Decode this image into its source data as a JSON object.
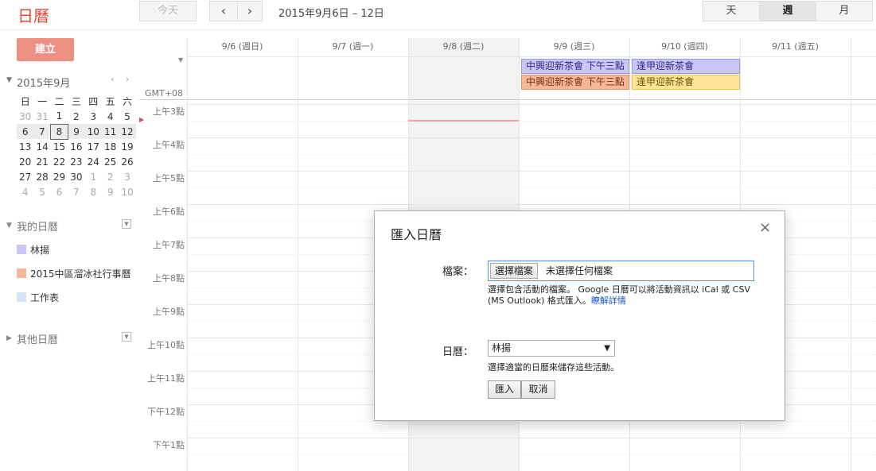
{
  "app": {
    "title": "日曆"
  },
  "toolbar": {
    "today": "今天",
    "prev": "‹",
    "next": "›",
    "date_range": "2015年9月6日 – 12日",
    "views": {
      "day": "天",
      "week": "週",
      "month": "月"
    },
    "selected_view": "week"
  },
  "sidebar": {
    "create": "建立",
    "mini_calendar": {
      "month_label": "2015年9月",
      "prev": "‹",
      "next": "›",
      "weekdays": [
        "日",
        "一",
        "二",
        "三",
        "四",
        "五",
        "六"
      ],
      "weeks": [
        [
          {
            "d": "30",
            "o": true
          },
          {
            "d": "31",
            "o": true
          },
          {
            "d": "1"
          },
          {
            "d": "2"
          },
          {
            "d": "3"
          },
          {
            "d": "4"
          },
          {
            "d": "5"
          }
        ],
        [
          {
            "d": "6"
          },
          {
            "d": "7"
          },
          {
            "d": "8",
            "today": true
          },
          {
            "d": "9"
          },
          {
            "d": "10"
          },
          {
            "d": "11"
          },
          {
            "d": "12"
          }
        ],
        [
          {
            "d": "13"
          },
          {
            "d": "14"
          },
          {
            "d": "15"
          },
          {
            "d": "16"
          },
          {
            "d": "17"
          },
          {
            "d": "18"
          },
          {
            "d": "19"
          }
        ],
        [
          {
            "d": "20"
          },
          {
            "d": "21"
          },
          {
            "d": "22"
          },
          {
            "d": "23"
          },
          {
            "d": "24"
          },
          {
            "d": "25"
          },
          {
            "d": "26"
          }
        ],
        [
          {
            "d": "27"
          },
          {
            "d": "28"
          },
          {
            "d": "29"
          },
          {
            "d": "30"
          },
          {
            "d": "1",
            "o": true
          },
          {
            "d": "2",
            "o": true
          },
          {
            "d": "3",
            "o": true
          }
        ],
        [
          {
            "d": "4",
            "o": true
          },
          {
            "d": "5",
            "o": true
          },
          {
            "d": "6",
            "o": true
          },
          {
            "d": "7",
            "o": true
          },
          {
            "d": "8",
            "o": true
          },
          {
            "d": "9",
            "o": true
          },
          {
            "d": "10",
            "o": true
          }
        ]
      ],
      "selected_week_index": 1
    },
    "my_calendars": {
      "title": "我的日曆",
      "items": [
        {
          "name": "林揚",
          "color": "#c9c6f5"
        },
        {
          "name": "2015中區溜冰社行事曆",
          "color": "#f6b699"
        },
        {
          "name": "工作表",
          "color": "#d4e3f6"
        }
      ]
    },
    "other_calendars": {
      "title": "其他日曆"
    }
  },
  "grid": {
    "timezone": "GMT+08",
    "days": [
      "9/6 (週日)",
      "9/7 (週一)",
      "9/8 (週二)",
      "9/9 (週三)",
      "9/10 (週四)",
      "9/11 (週五)"
    ],
    "today_index": 2,
    "hours": [
      "上午3點",
      "上午4點",
      "上午5點",
      "上午6點",
      "上午7點",
      "上午8點",
      "上午9點",
      "上午10點",
      "上午11點",
      "下午12點",
      "下午1點"
    ],
    "all_day_events": [
      {
        "title": "中興迎新茶會 下午三點",
        "day": 3,
        "row": 0,
        "style": "purple"
      },
      {
        "title": "中興迎新茶會 下午三點",
        "day": 3,
        "row": 1,
        "style": "salmon"
      },
      {
        "title": "逢甲迎新茶會",
        "day": 4,
        "row": 0,
        "style": "purple"
      },
      {
        "title": "逢甲迎新茶會",
        "day": 4,
        "row": 1,
        "style": "yellow"
      }
    ]
  },
  "dialog": {
    "title": "匯入日曆",
    "close": "×",
    "file_label": "檔案：",
    "file_button": "選擇檔案",
    "file_status": "未選擇任何檔案",
    "file_help": "選擇包含活動的檔案。 Google 日曆可以將活動資訊以 iCal 或 CSV (MS Outlook) 格式匯入。",
    "learn_more": "瞭解詳情",
    "calendar_label": "日曆：",
    "calendar_value": "林揚",
    "calendar_help": "選擇適當的日曆來儲存這些活動。",
    "import_button": "匯入",
    "cancel_button": "取消"
  }
}
